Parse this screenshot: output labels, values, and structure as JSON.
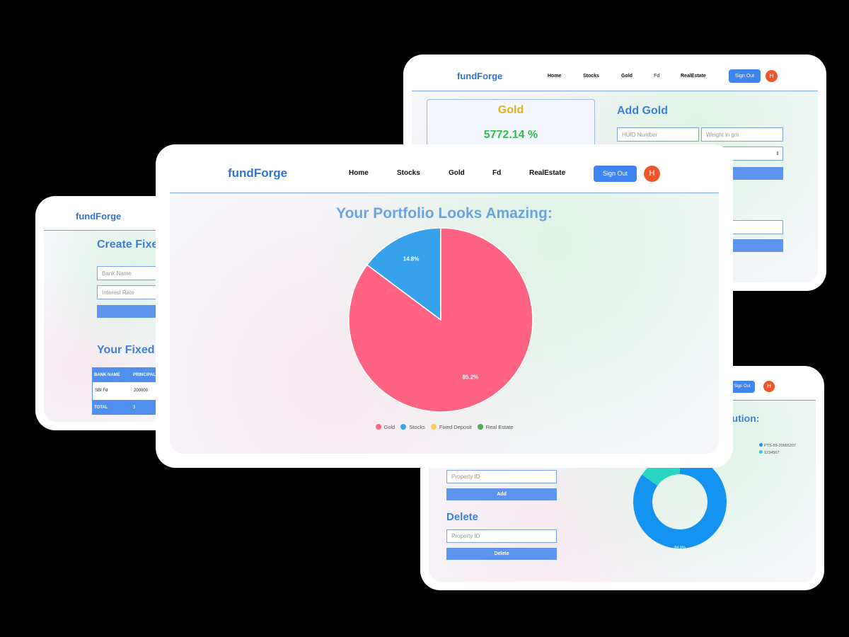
{
  "nav": {
    "logo": "fundForge",
    "links": [
      "Home",
      "Stocks",
      "Gold",
      "Fd",
      "RealEstate"
    ],
    "sign_out": "Sign Out",
    "avatar_initial": "H"
  },
  "colors": {
    "primary": "#3f84ef",
    "title_blue": "#3d7fd8",
    "avatar": "#f0552a",
    "gold_title": "#e2b11d",
    "gain_green": "#2ec050"
  },
  "gold_window": {
    "summary_title": "Gold",
    "summary_value": "5772.14 %",
    "form_title": "Add Gold",
    "huid_placeholder": "HUID Number",
    "weight_placeholder": "Weight in gm"
  },
  "fd_window": {
    "create_title": "Create Fixe",
    "bank_placeholder": "Bank Name",
    "rate_placeholder": "Interest Rate",
    "list_title": "Your Fixed I",
    "table": {
      "headers": [
        "BANK NAME",
        "PRINCIPAL"
      ],
      "rows": [
        [
          "SBI Fd",
          "200000"
        ]
      ],
      "total_label": "TOTAL",
      "total_value": "3"
    }
  },
  "realestate_window": {
    "distribution_title": "bution:",
    "property_placeholder": "Property ID",
    "add_label": "Add",
    "delete_title": "Delete",
    "delete_placeholder": "Property ID",
    "delete_label": "Delete",
    "legend": [
      "PTS-89-20665207",
      "1234567"
    ],
    "donut_label": "84.9%"
  },
  "main_window": {
    "heading": "Your Portfolio Looks Amazing:"
  },
  "chart_data": {
    "type": "pie",
    "title": "",
    "categories": [
      "Gold",
      "Stocks",
      "Fixed Deposit",
      "Real Estate"
    ],
    "values": [
      85.2,
      14.8,
      0,
      0
    ],
    "value_labels": [
      "85.2%",
      "14.8%",
      "",
      ""
    ],
    "colors": [
      "#ff6384",
      "#36a2eb",
      "#ffcd56",
      "#4caf50"
    ],
    "legend_position": "bottom"
  },
  "donut_data": {
    "values": [
      84.9,
      15.1
    ],
    "colors": [
      "#1493f0",
      "#2ad3c4"
    ]
  }
}
